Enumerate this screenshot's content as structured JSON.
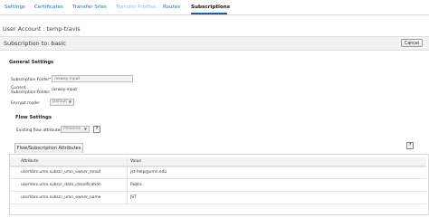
{
  "nav": {
    "tabs": [
      {
        "label": "Settings",
        "state": "normal"
      },
      {
        "label": "Certificates",
        "state": "normal"
      },
      {
        "label": "Transfer Sites",
        "state": "normal"
      },
      {
        "label": "Transfer Profiles",
        "state": "disabled"
      },
      {
        "label": "Routes",
        "state": "normal"
      },
      {
        "label": "Subscriptions",
        "state": "active"
      }
    ]
  },
  "user_account": "User Account : temp-travis",
  "subscription": {
    "title": "Subscription to: basic",
    "cancel_label": "Cancel"
  },
  "general_settings": {
    "title": "General Settings",
    "folder_label": "Subscription Folder*:",
    "folder_value": "/asway-input",
    "current_folder_label": "Current Subscription Folder:",
    "current_folder_value": "/asway-input",
    "encrypt_label": "Encrypt mode:",
    "encrypt_value": "Default"
  },
  "flow_settings": {
    "title": "Flow Settings",
    "existing_label": "Existing flow attributes:",
    "existing_value": "Preserve",
    "help": "?"
  },
  "attributes": {
    "tab_label": "Flow/Subscription Attributes",
    "help": "?",
    "columns": [
      "Attribute",
      "Value"
    ],
    "rows": [
      {
        "attribute": "userVars.umn.subscr_umn_owner_email",
        "value": "jst-help@umn.edu"
      },
      {
        "attribute": "userVars.umn.subscr_data_classification",
        "value": "Public"
      },
      {
        "attribute": "userVars.umn.subscr_umn_owner_name",
        "value": "JST"
      }
    ]
  },
  "colors": {
    "link": "#2a6db5",
    "active_underline": "#1f5fa8"
  }
}
